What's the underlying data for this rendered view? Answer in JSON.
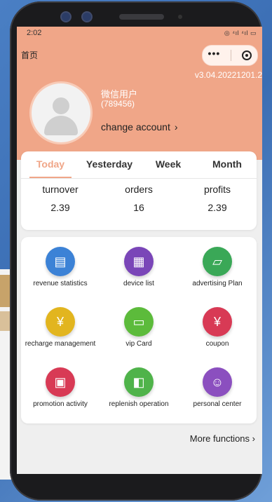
{
  "status_bar": {
    "time": "2:02",
    "left_icons": "▣ ✱ ⊡ ⅈ",
    "right_icons": "◎ ⁴ıl ⁴ıl ▭"
  },
  "nav": {
    "home": "首页",
    "menu_icon": "•••"
  },
  "version": "v3.04.20221201.2",
  "user": {
    "name": "微信用户",
    "id": "(789456)",
    "change_account": "change account",
    "chevron": "›"
  },
  "tabs": [
    {
      "label": "Today",
      "active": true
    },
    {
      "label": "Yesterday",
      "active": false
    },
    {
      "label": "Week",
      "active": false
    },
    {
      "label": "Month",
      "active": false
    }
  ],
  "stats": [
    {
      "label": "turnover",
      "value": "2.39"
    },
    {
      "label": "orders",
      "value": "16"
    },
    {
      "label": "profits",
      "value": "2.39"
    }
  ],
  "functions": [
    {
      "label": "revenue statistics",
      "icon": "document-chart-icon",
      "glyph": "▤",
      "color": "#3c82d6"
    },
    {
      "label": "device list",
      "icon": "vending-machine-icon",
      "glyph": "▦",
      "color": "#7a46b8"
    },
    {
      "label": "advertising Plan",
      "icon": "ad-plan-icon",
      "glyph": "▱",
      "color": "#3aa857"
    },
    {
      "label": "recharge management",
      "icon": "recharge-coin-icon",
      "glyph": "¥",
      "color": "#e2b51f"
    },
    {
      "label": "vip Card",
      "icon": "vip-card-icon",
      "glyph": "▭",
      "color": "#5cbb3b"
    },
    {
      "label": "coupon",
      "icon": "coupon-icon",
      "glyph": "¥",
      "color": "#d83a55"
    },
    {
      "label": "promotion activity",
      "icon": "promotion-icon",
      "glyph": "▣",
      "color": "#d83a55"
    },
    {
      "label": "replenish operation",
      "icon": "replenish-icon",
      "glyph": "◧",
      "color": "#4fb34a"
    },
    {
      "label": "personal center",
      "icon": "user-icon",
      "glyph": "☺",
      "color": "#8b4fbf"
    }
  ],
  "more_functions": "More functions",
  "more_chevron": "›",
  "colors": {
    "accent": "#f0a688",
    "screen_bg": "#efefef"
  }
}
